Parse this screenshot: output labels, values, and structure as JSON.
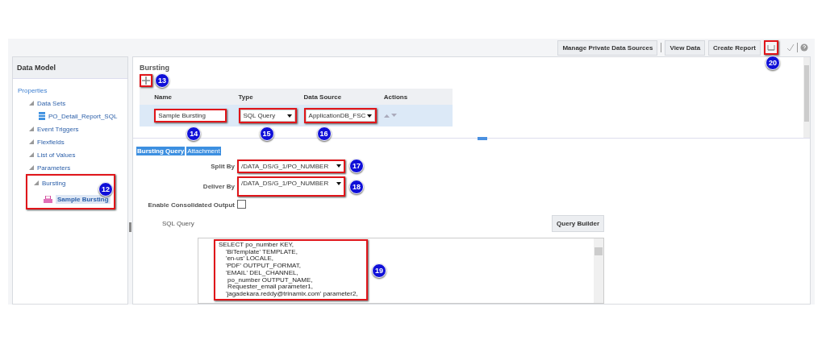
{
  "toolbar": {
    "buttons": [
      "Manage Private Data Sources",
      "View Data",
      "Create Report"
    ],
    "callout": "20"
  },
  "sidebar": {
    "title": "Data Model",
    "callout": "12",
    "items": [
      {
        "label": "Properties",
        "kind": "link",
        "selected": false,
        "children": [
          {
            "label": "Data Sets",
            "kind": "folder",
            "selected": false,
            "children": [
              {
                "label": "PO_Detail_Report_SQL",
                "kind": "dataset",
                "selected": false
              }
            ]
          },
          {
            "label": "Event Triggers",
            "kind": "folder",
            "selected": false
          },
          {
            "label": "Flexfields",
            "kind": "folder",
            "selected": false
          },
          {
            "label": "List of Values",
            "kind": "folder",
            "selected": false
          },
          {
            "label": "Parameters",
            "kind": "folder",
            "selected": false
          },
          {
            "label": "Bursting",
            "kind": "folder",
            "selected": false,
            "children": [
              {
                "label": "Sample Bursting",
                "kind": "bursting",
                "selected": true
              }
            ]
          }
        ]
      }
    ]
  },
  "bursting": {
    "title": "Bursting",
    "add_callout": "13",
    "columns": [
      "Name",
      "Type",
      "Data Source",
      "Actions"
    ],
    "row": {
      "name": "Sample Bursting",
      "name_callout": "14",
      "type": "SQL Query",
      "type_callout": "15",
      "data_source": "ApplicationDB_FSC",
      "data_source_callout": "16"
    },
    "tabs": [
      "Bursting Query",
      "Attachment"
    ],
    "split_by": {
      "label": "Split By",
      "value": "/DATA_DS/G_1/PO_NUMBER",
      "callout": "17"
    },
    "deliver_by": {
      "label": "Deliver By",
      "value": "/DATA_DS/G_1/PO_NUMBER",
      "callout": "18"
    },
    "consolidated": {
      "label": "Enable Consolidated Output",
      "checked": false
    },
    "sql": {
      "label": "SQL Query",
      "button": "Query Builder",
      "callout": "19",
      "lines": [
        "SELECT po_number KEY,",
        "    'BITemplate' TEMPLATE,",
        "    'en-us' LOCALE,",
        "    'PDF' OUTPUT_FORMAT,",
        "    'EMAIL' DEL_CHANNEL,",
        "     po_number OUTPUT_NAME,",
        "     Requester_email parameter1,",
        "    'jagadekara.reddy@trinamix.com' parameter2,"
      ]
    }
  }
}
